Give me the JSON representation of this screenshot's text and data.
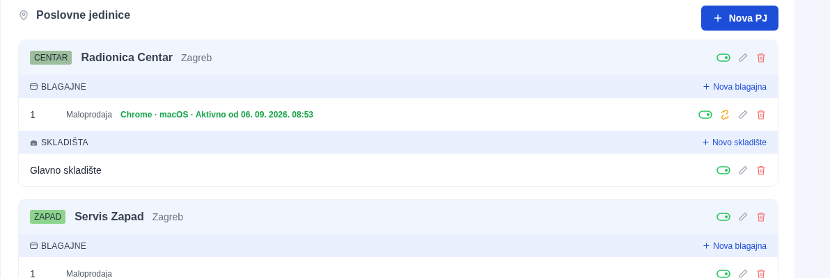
{
  "title": "Poslovne jedinice",
  "new_button": "Nova PJ",
  "units": [
    {
      "tag": "CENTAR",
      "color": "#9dbf9d",
      "name": "Radionica Centar",
      "city": "Zagreb",
      "active": true,
      "sections": [
        {
          "kind": "registers",
          "title": "BLAGAJNE",
          "add": "Nova blagajna",
          "rows": [
            {
              "number": "1",
              "name": "Maloprodaja",
              "session": "Chrome · macOS · Aktivno od 06. 09. 2026. 08:53",
              "active": true,
              "paired": true
            }
          ]
        },
        {
          "kind": "warehouses",
          "title": "SKLADIŠTA",
          "add": "Novo skladište",
          "rows": [
            {
              "name": "Glavno skladište",
              "active": true
            }
          ]
        }
      ]
    },
    {
      "tag": "ZAPAD",
      "color": "#8dd48d",
      "name": "Servis Zapad",
      "city": "Zagreb",
      "active": true,
      "sections": [
        {
          "kind": "registers",
          "title": "BLAGAJNE",
          "add": "Nova blagajna",
          "rows": [
            {
              "number": "1",
              "name": "Maloprodaja",
              "active": true,
              "paired": false
            }
          ]
        }
      ]
    }
  ]
}
